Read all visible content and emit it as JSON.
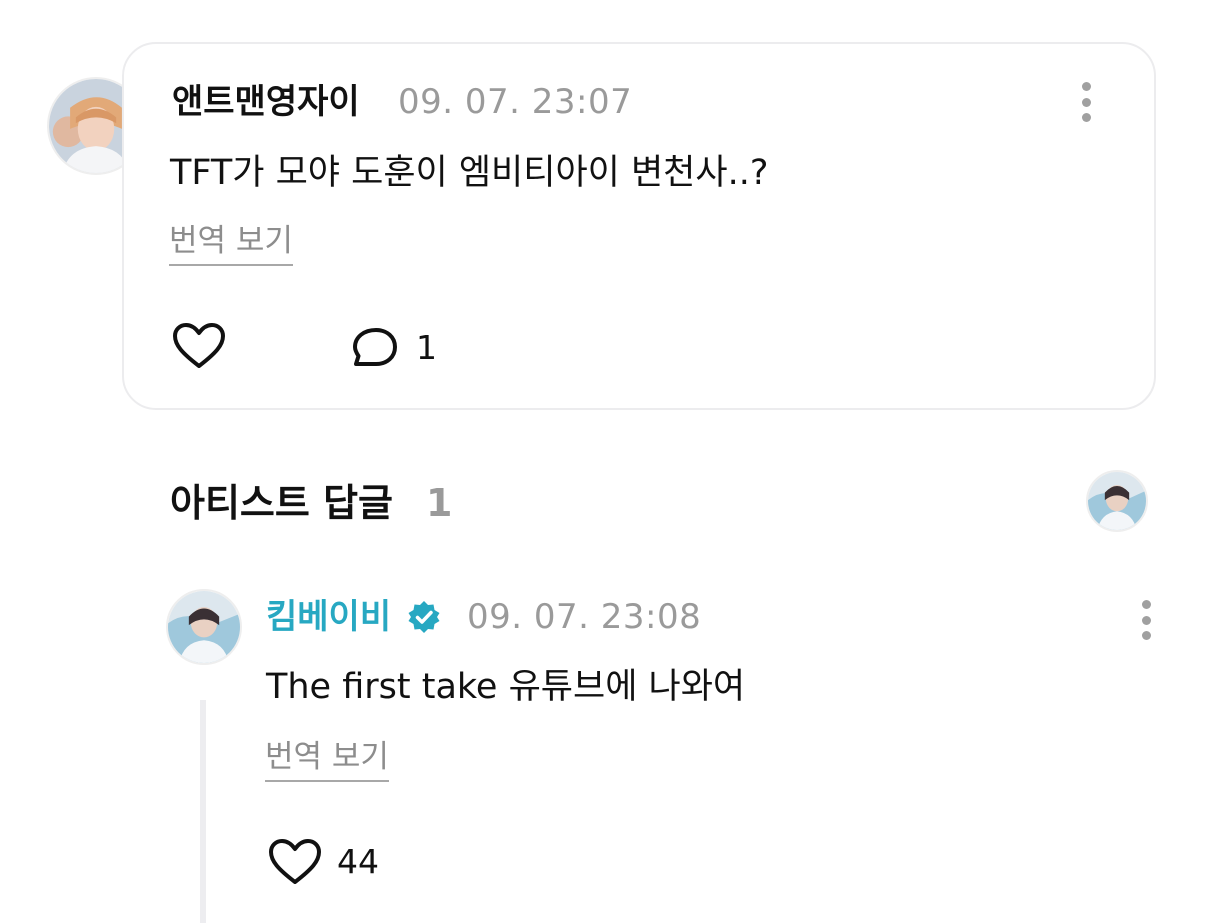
{
  "comment": {
    "author": "앤트맨영자이",
    "timestamp": "09. 07. 23:07",
    "text": "TFT가 모야 도훈이 엠비티아이 변천사..?",
    "translate_label": "번역 보기",
    "reply_count": "1",
    "icons": {
      "like": "heart-icon",
      "reply": "speech-bubble-icon",
      "more": "kebab-menu-icon"
    }
  },
  "artist_replies": {
    "title": "아티스트 답글",
    "count": "1"
  },
  "reply": {
    "author": "킴베이비",
    "verified": true,
    "timestamp": "09. 07. 23:08",
    "text": "The first take 유튜브에 나와여",
    "translate_label": "번역 보기",
    "like_count": "44",
    "icons": {
      "like": "heart-icon",
      "badge": "verified-badge-icon",
      "more": "kebab-menu-icon"
    }
  },
  "colors": {
    "artist_name": "#27a8c2",
    "verified_badge": "#27a8c2",
    "meta_gray": "#9a9a9a",
    "card_border": "#ececee"
  }
}
